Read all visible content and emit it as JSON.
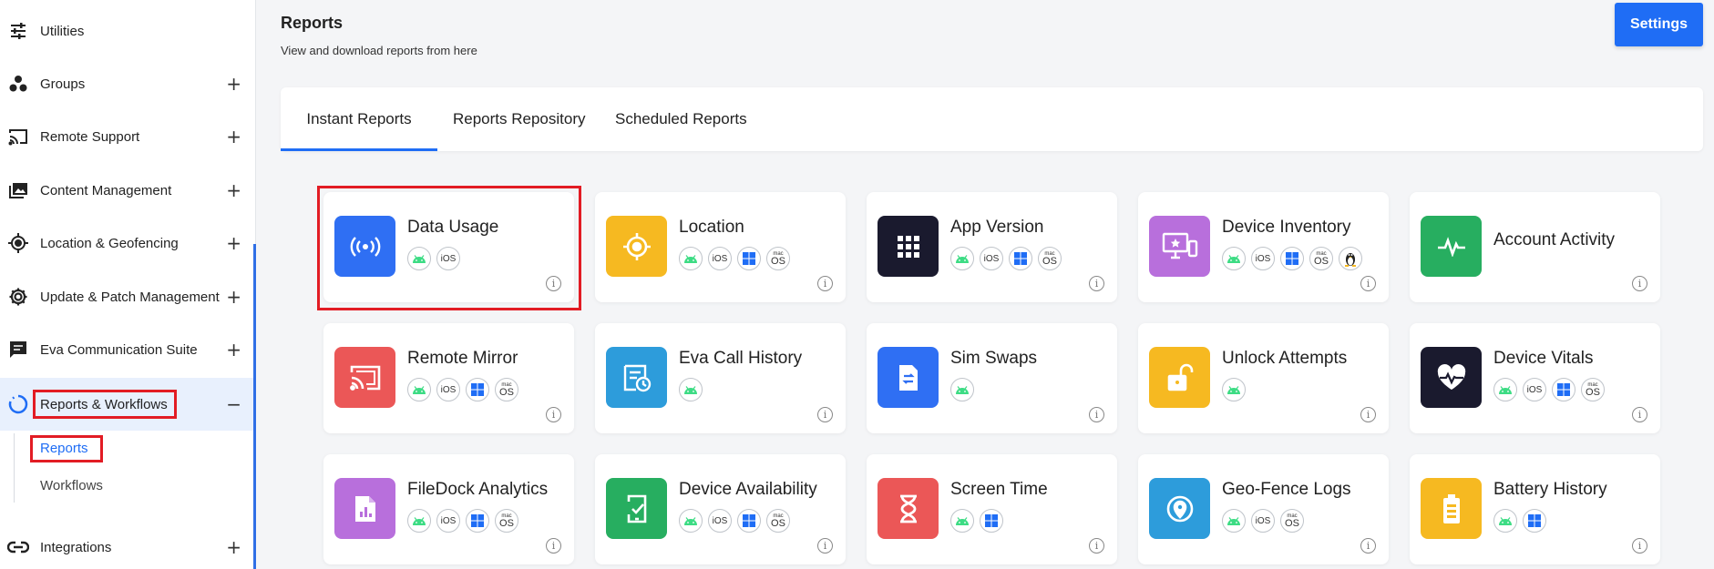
{
  "sidebar": {
    "items": [
      {
        "label": "Utilities",
        "icon": "sliders-icon",
        "toggle": ""
      },
      {
        "label": "Groups",
        "icon": "groups-icon",
        "toggle": "+"
      },
      {
        "label": "Remote Support",
        "icon": "cast-icon",
        "toggle": "+"
      },
      {
        "label": "Content Management",
        "icon": "photos-icon",
        "toggle": "+"
      },
      {
        "label": "Location & Geofencing",
        "icon": "target-icon",
        "toggle": "+"
      },
      {
        "label": "Update & Patch Management",
        "icon": "gear-icon",
        "toggle": "+"
      },
      {
        "label": "Eva Communication Suite",
        "icon": "chat-icon",
        "toggle": "+"
      },
      {
        "label": "Reports & Workflows",
        "icon": "circle-progress-icon",
        "toggle": "−"
      },
      {
        "label": "Integrations",
        "icon": "link-icon",
        "toggle": "+"
      }
    ],
    "subitems": [
      "Reports",
      "Workflows"
    ]
  },
  "header": {
    "title": "Reports",
    "subtitle": "View and download reports from here",
    "settings_label": "Settings"
  },
  "tabs": [
    "Instant Reports",
    "Reports Repository",
    "Scheduled Reports"
  ],
  "platform_labels": {
    "ios": "iOS",
    "macos_top": "mac",
    "macos_bottom": "OS"
  },
  "info_glyph": "i",
  "cards": [
    {
      "title": "Data Usage",
      "color": "#2f6ff3",
      "icon": "broadcast-icon",
      "platforms": [
        "android",
        "ios"
      ]
    },
    {
      "title": "Location",
      "color": "#f6b921",
      "icon": "crosshair-icon",
      "platforms": [
        "android",
        "ios",
        "windows",
        "macos"
      ]
    },
    {
      "title": "App Version",
      "color": "#1a1a2e",
      "icon": "grid-icon",
      "platforms": [
        "android",
        "ios",
        "windows",
        "macos"
      ]
    },
    {
      "title": "Device Inventory",
      "color": "#b86fdc",
      "icon": "devices-icon",
      "platforms": [
        "android",
        "ios",
        "windows",
        "macos",
        "linux"
      ]
    },
    {
      "title": "Account Activity",
      "color": "#27ae60",
      "icon": "pulse-icon",
      "platforms": []
    },
    {
      "title": "Remote Mirror",
      "color": "#eb5757",
      "icon": "cast-icon",
      "platforms": [
        "android",
        "ios",
        "windows",
        "macos"
      ]
    },
    {
      "title": "Eva Call History",
      "color": "#2d9cdb",
      "icon": "call-history-icon",
      "platforms": [
        "android"
      ]
    },
    {
      "title": "Sim Swaps",
      "color": "#2f6ff3",
      "icon": "sim-icon",
      "platforms": [
        "android"
      ]
    },
    {
      "title": "Unlock Attempts",
      "color": "#f6b921",
      "icon": "unlock-icon",
      "platforms": [
        "android"
      ]
    },
    {
      "title": "Device Vitals",
      "color": "#1a1a2e",
      "icon": "heart-pulse-icon",
      "platforms": [
        "android",
        "ios",
        "windows",
        "macos"
      ]
    },
    {
      "title": "FileDock Analytics",
      "color": "#b86fdc",
      "icon": "file-chart-icon",
      "platforms": [
        "android",
        "ios",
        "windows",
        "macos"
      ]
    },
    {
      "title": "Device Availability",
      "color": "#27ae60",
      "icon": "phone-check-icon",
      "platforms": [
        "android",
        "ios",
        "windows",
        "macos"
      ]
    },
    {
      "title": "Screen Time",
      "color": "#eb5757",
      "icon": "hourglass-icon",
      "platforms": [
        "android",
        "windows"
      ]
    },
    {
      "title": "Geo-Fence Logs",
      "color": "#2d9cdb",
      "icon": "geofence-icon",
      "platforms": [
        "android",
        "ios",
        "macos"
      ]
    },
    {
      "title": "Battery History",
      "color": "#f6b921",
      "icon": "battery-icon",
      "platforms": [
        "android",
        "windows"
      ]
    }
  ]
}
